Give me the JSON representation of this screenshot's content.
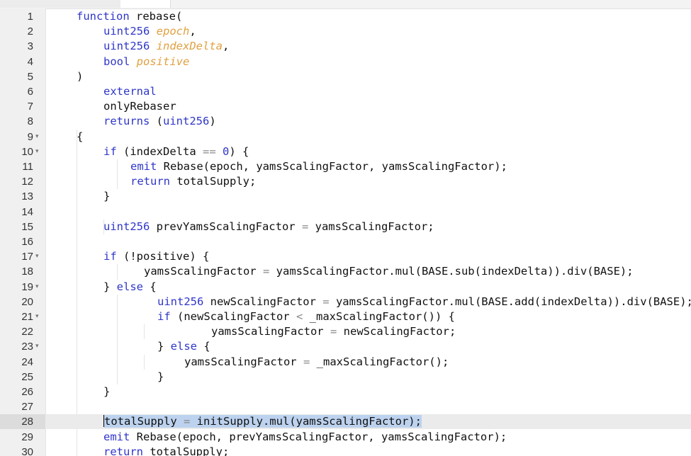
{
  "editor": {
    "lines": [
      {
        "n": "1",
        "fold": "",
        "indent": 0,
        "tokens": [
          {
            "t": "function rebase(",
            "c": "kw-mix"
          }
        ]
      },
      {
        "n": "2",
        "fold": "",
        "indent": 1,
        "tokens": [
          {
            "t": "uint256 ",
            "c": "ty"
          },
          {
            "t": "epoch",
            "c": "pa"
          },
          {
            "t": ",",
            "c": ""
          }
        ]
      },
      {
        "n": "3",
        "fold": "",
        "indent": 1,
        "tokens": [
          {
            "t": "uint256 ",
            "c": "ty"
          },
          {
            "t": "indexDelta",
            "c": "pa"
          },
          {
            "t": ",",
            "c": ""
          }
        ]
      },
      {
        "n": "4",
        "fold": "",
        "indent": 1,
        "tokens": [
          {
            "t": "bool ",
            "c": "ty"
          },
          {
            "t": "positive",
            "c": "pa"
          }
        ]
      },
      {
        "n": "5",
        "fold": "",
        "indent": 0,
        "tokens": [
          {
            "t": ")",
            "c": ""
          }
        ]
      },
      {
        "n": "6",
        "fold": "",
        "indent": 1,
        "tokens": [
          {
            "t": "external",
            "c": "kw"
          }
        ]
      },
      {
        "n": "7",
        "fold": "",
        "indent": 1,
        "tokens": [
          {
            "t": "onlyRebaser",
            "c": ""
          }
        ]
      },
      {
        "n": "8",
        "fold": "",
        "indent": 1,
        "tokens": [
          {
            "t": "returns ",
            "c": "kw"
          },
          {
            "t": "(",
            "c": ""
          },
          {
            "t": "uint256",
            "c": "ty"
          },
          {
            "t": ")",
            "c": ""
          }
        ]
      },
      {
        "n": "9",
        "fold": "▾",
        "indent": 0,
        "tokens": [
          {
            "t": "{",
            "c": ""
          }
        ]
      },
      {
        "n": "10",
        "fold": "▾",
        "indent": 1,
        "tokens": [
          {
            "t": "if ",
            "c": "kw"
          },
          {
            "t": "(indexDelta ",
            "c": ""
          },
          {
            "t": "==",
            "c": "op"
          },
          {
            "t": " ",
            "c": ""
          },
          {
            "t": "0",
            "c": "nu"
          },
          {
            "t": ") {",
            "c": ""
          }
        ]
      },
      {
        "n": "11",
        "fold": "",
        "indent": 2,
        "tokens": [
          {
            "t": "emit ",
            "c": "kw"
          },
          {
            "t": "Rebase(epoch, yamsScalingFactor, yamsScalingFactor);",
            "c": ""
          }
        ]
      },
      {
        "n": "12",
        "fold": "",
        "indent": 2,
        "tokens": [
          {
            "t": "return ",
            "c": "kw"
          },
          {
            "t": "totalSupply;",
            "c": ""
          }
        ]
      },
      {
        "n": "13",
        "fold": "",
        "indent": 1,
        "tokens": [
          {
            "t": "}",
            "c": ""
          }
        ]
      },
      {
        "n": "14",
        "fold": "",
        "indent": 0,
        "tokens": []
      },
      {
        "n": "15",
        "fold": "",
        "indent": 1,
        "tokens": [
          {
            "t": "uint256 ",
            "c": "ty"
          },
          {
            "t": "prevYamsScalingFactor ",
            "c": ""
          },
          {
            "t": "=",
            "c": "op"
          },
          {
            "t": " yamsScalingFactor;",
            "c": ""
          }
        ]
      },
      {
        "n": "16",
        "fold": "",
        "indent": 0,
        "tokens": []
      },
      {
        "n": "17",
        "fold": "▾",
        "indent": 1,
        "tokens": [
          {
            "t": "if ",
            "c": "kw"
          },
          {
            "t": "(!positive) {",
            "c": ""
          }
        ]
      },
      {
        "n": "18",
        "fold": "",
        "indent": 2.5,
        "tokens": [
          {
            "t": "yamsScalingFactor ",
            "c": ""
          },
          {
            "t": "=",
            "c": "op"
          },
          {
            "t": " yamsScalingFactor.mul(BASE.sub(indexDelta)).div(BASE);",
            "c": ""
          }
        ]
      },
      {
        "n": "19",
        "fold": "▾",
        "indent": 1,
        "tokens": [
          {
            "t": "} ",
            "c": ""
          },
          {
            "t": "else",
            "c": "kw"
          },
          {
            "t": " {",
            "c": ""
          }
        ]
      },
      {
        "n": "20",
        "fold": "",
        "indent": 3,
        "tokens": [
          {
            "t": "uint256 ",
            "c": "ty"
          },
          {
            "t": "newScalingFactor ",
            "c": ""
          },
          {
            "t": "=",
            "c": "op"
          },
          {
            "t": " yamsScalingFactor.mul(BASE.add(indexDelta)).div(BASE);",
            "c": ""
          }
        ]
      },
      {
        "n": "21",
        "fold": "▾",
        "indent": 3,
        "tokens": [
          {
            "t": "if ",
            "c": "kw"
          },
          {
            "t": "(newScalingFactor ",
            "c": ""
          },
          {
            "t": "<",
            "c": "op"
          },
          {
            "t": " _maxScalingFactor()) {",
            "c": ""
          }
        ]
      },
      {
        "n": "22",
        "fold": "",
        "indent": 5,
        "tokens": [
          {
            "t": "yamsScalingFactor ",
            "c": ""
          },
          {
            "t": "=",
            "c": "op"
          },
          {
            "t": " newScalingFactor;",
            "c": ""
          }
        ]
      },
      {
        "n": "23",
        "fold": "▾",
        "indent": 3,
        "tokens": [
          {
            "t": "} ",
            "c": ""
          },
          {
            "t": "else",
            "c": "kw"
          },
          {
            "t": " {",
            "c": ""
          }
        ]
      },
      {
        "n": "24",
        "fold": "",
        "indent": 4,
        "tokens": [
          {
            "t": "yamsScalingFactor ",
            "c": ""
          },
          {
            "t": "=",
            "c": "op"
          },
          {
            "t": " _maxScalingFactor();",
            "c": ""
          }
        ]
      },
      {
        "n": "25",
        "fold": "",
        "indent": 3,
        "tokens": [
          {
            "t": "}",
            "c": ""
          }
        ]
      },
      {
        "n": "26",
        "fold": "",
        "indent": 1,
        "tokens": [
          {
            "t": "}",
            "c": ""
          }
        ]
      },
      {
        "n": "27",
        "fold": "",
        "indent": 0,
        "tokens": []
      },
      {
        "n": "28",
        "fold": "",
        "indent": 1,
        "active": true,
        "tokens": [
          {
            "t": "totalSupply ",
            "c": "sel"
          },
          {
            "t": "=",
            "c": "sel op"
          },
          {
            "t": " initSupply.mul(yamsScalingFactor);",
            "c": "sel"
          }
        ]
      },
      {
        "n": "29",
        "fold": "",
        "indent": 1,
        "tokens": [
          {
            "t": "emit ",
            "c": "kw"
          },
          {
            "t": "Rebase(epoch, prevYamsScalingFactor, yamsScalingFactor);",
            "c": ""
          }
        ]
      },
      {
        "n": "30",
        "fold": "",
        "indent": 1,
        "tokens": [
          {
            "t": "return ",
            "c": "kw"
          },
          {
            "t": "totalSupply;",
            "c": ""
          }
        ]
      }
    ]
  }
}
